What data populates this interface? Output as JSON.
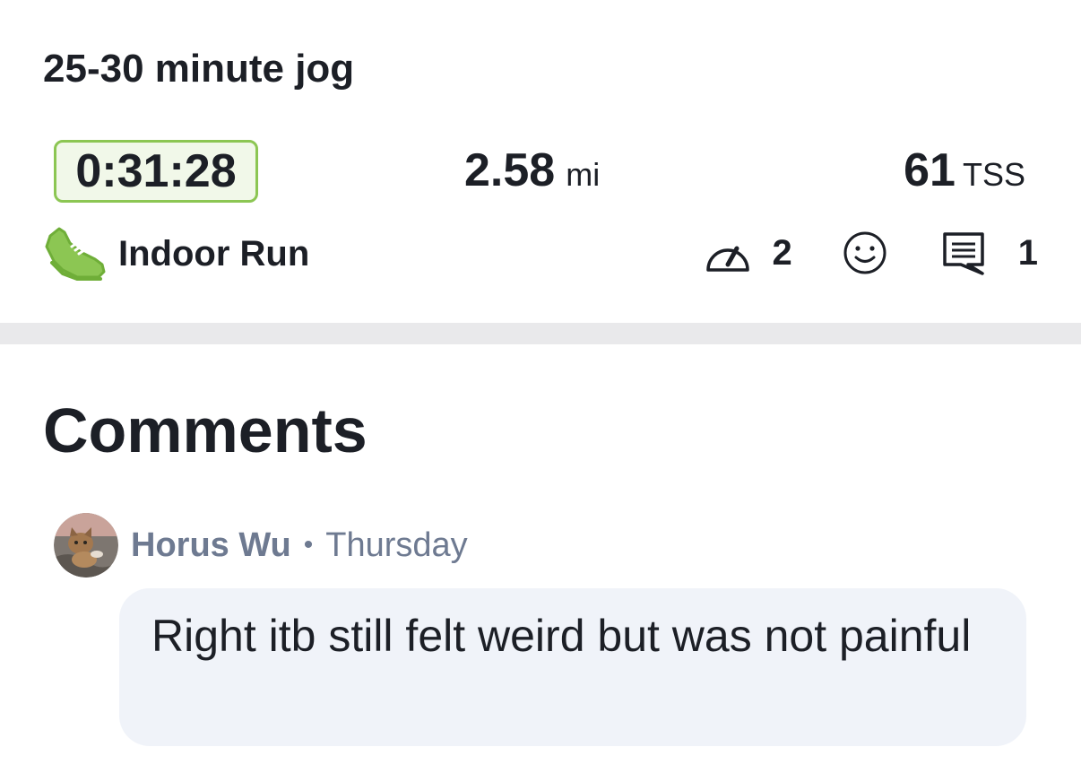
{
  "workout": {
    "title": "25-30 minute jog",
    "duration": "0:31:28",
    "distance_value": "2.58",
    "distance_unit": "mi",
    "tss_value": "61",
    "tss_unit": "TSS",
    "sport_label": "Indoor Run",
    "sport_icon": "running-shoe-icon",
    "accent_color": "#8cc653"
  },
  "metrics": {
    "effort_icon": "speedometer-icon",
    "effort_count": "2",
    "feeling_icon": "smiley-icon",
    "comments_icon": "comment-icon",
    "comments_count": "1"
  },
  "comments": {
    "heading": "Comments",
    "items": [
      {
        "author": "Horus Wu",
        "separator": "•",
        "time": "Thursday",
        "text": "Right itb still felt weird but was not painful",
        "avatar": "cat-avatar"
      }
    ]
  }
}
